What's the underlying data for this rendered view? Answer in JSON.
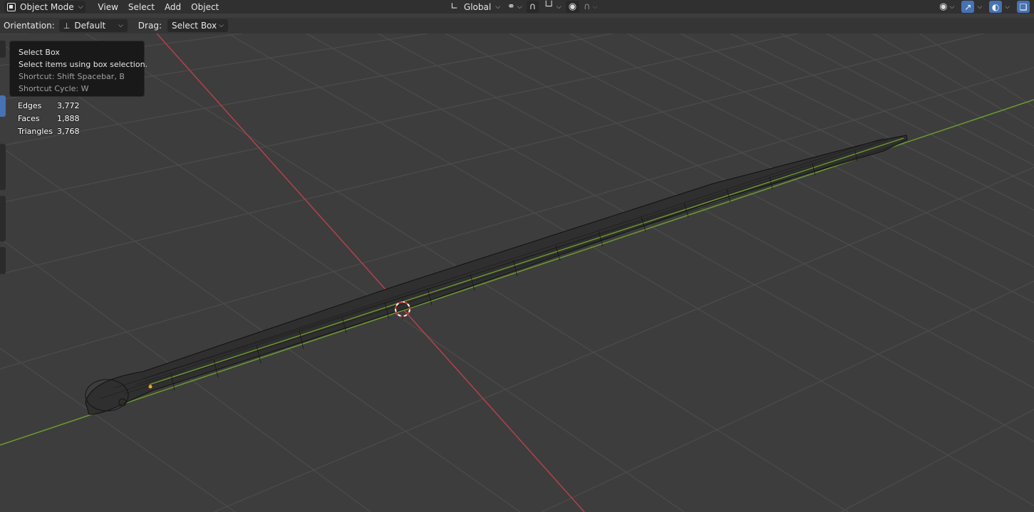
{
  "header": {
    "mode_label": "Object Mode",
    "menu": [
      "View",
      "Select",
      "Add",
      "Object"
    ],
    "transform_orientation": "Global"
  },
  "toolbar": {
    "orientation_label": "Orientation:",
    "orientation_value": "Default",
    "drag_label": "Drag:",
    "drag_value": "Select Box"
  },
  "tooltip": {
    "title": "Select Box",
    "description": "Select items using box selection.",
    "shortcut": "Shortcut: Shift Spacebar, B",
    "shortcut_cycle": "Shortcut Cycle: W"
  },
  "stats": [
    {
      "label": "Edges",
      "value": "3,772"
    },
    {
      "label": "Faces",
      "value": "1,888"
    },
    {
      "label": "Triangles",
      "value": "3,768"
    }
  ],
  "colors": {
    "x_axis": "#b5414c",
    "y_axis": "#6f9a2e",
    "accent": "#4772b3",
    "grid": "#4a4a4a",
    "background": "#3d3d3d"
  },
  "icons": {
    "mode": "object-mode-icon",
    "orientation": "transform-orientation-icon",
    "pivot": "pivot-point-icon",
    "snap": "snap-magnet-icon",
    "snap_target": "snap-increment-icon",
    "proportional": "proportional-edit-icon",
    "falloff": "falloff-curve-icon",
    "visibility": "eye-visibility-icon",
    "gizmo": "gizmo-icon",
    "overlay": "overlay-icon",
    "xray": "xray-toggle-icon"
  }
}
